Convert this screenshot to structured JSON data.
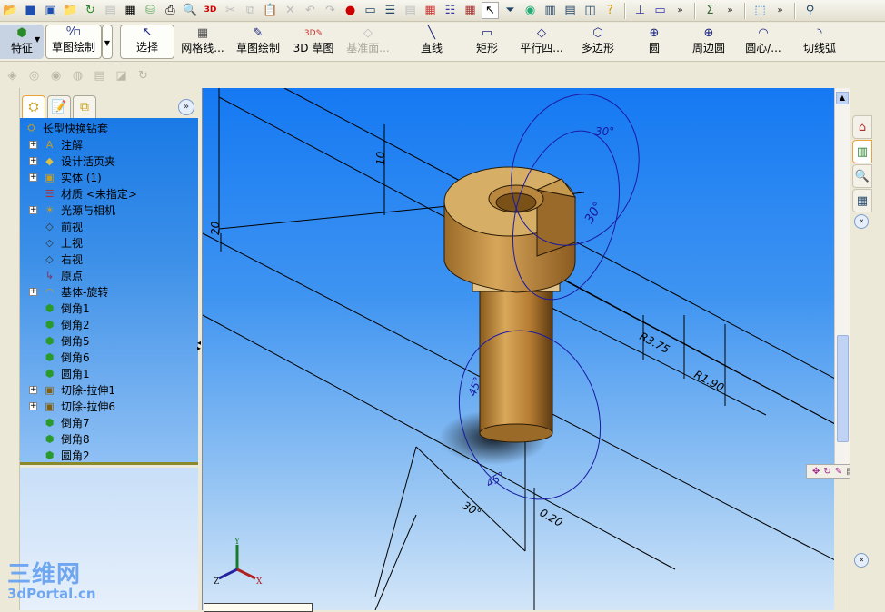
{
  "top_toolbar": {
    "icons": [
      "open-folder-icon",
      "save-icon",
      "save-all-icon",
      "open-icon",
      "rebuild-icon",
      "options-icon",
      "properties-icon",
      "print-setup-icon",
      "print-icon",
      "print-preview-icon",
      "3d-icon",
      "cut-icon",
      "copy-icon",
      "paste-icon",
      "delete-icon",
      "undo-icon",
      "redo-icon",
      "traffic-light-icon",
      "view-layout-icon",
      "list-icon",
      "notes-icon",
      "color-grid-icon",
      "layers-icon",
      "brick-icon",
      "select-arrow-icon",
      "filter-icon",
      "globe-icon",
      "tile-icon",
      "split-icon",
      "window-icon",
      "help-icon",
      "weldment-icon",
      "sheet-icon",
      "equation-icon",
      "box-icon",
      "probe-icon"
    ],
    "more": "»"
  },
  "command_manager": {
    "features_label": "特征",
    "sketch_tab_label": "草图绘制",
    "buttons": [
      {
        "label": "选择",
        "icon": "arrow"
      },
      {
        "label": "网格线...",
        "icon": "grid"
      },
      {
        "label": "草图绘制",
        "icon": "sketch"
      },
      {
        "label": "3D 草图",
        "icon": "3d-sketch"
      },
      {
        "label": "基准面...",
        "icon": "plane",
        "disabled": true
      },
      {
        "label": "直线",
        "icon": "line"
      },
      {
        "label": "矩形",
        "icon": "rectangle"
      },
      {
        "label": "平行四...",
        "icon": "parallelogram"
      },
      {
        "label": "多边形",
        "icon": "polygon"
      },
      {
        "label": "圆",
        "icon": "circle"
      },
      {
        "label": "周边圆",
        "icon": "perimeter-circle"
      },
      {
        "label": "圆心/...",
        "icon": "center-arc"
      },
      {
        "label": "切线弧",
        "icon": "tangent-arc"
      }
    ]
  },
  "feature_tree": {
    "root": "长型快换钻套",
    "items": [
      {
        "label": "注解",
        "expandable": true,
        "icon": "annotation"
      },
      {
        "label": "设计活页夹",
        "expandable": true,
        "icon": "binder"
      },
      {
        "label": "实体 (1)",
        "expandable": true,
        "icon": "solid-body"
      },
      {
        "label": "材质 <未指定>",
        "expandable": false,
        "icon": "material"
      },
      {
        "label": "光源与相机",
        "expandable": true,
        "icon": "lights"
      },
      {
        "label": "前视",
        "expandable": false,
        "icon": "plane"
      },
      {
        "label": "上视",
        "expandable": false,
        "icon": "plane"
      },
      {
        "label": "右视",
        "expandable": false,
        "icon": "plane"
      },
      {
        "label": "原点",
        "expandable": false,
        "icon": "origin"
      },
      {
        "label": "基体-旋转",
        "expandable": true,
        "icon": "revolve"
      },
      {
        "label": "倒角1",
        "expandable": false,
        "icon": "chamfer"
      },
      {
        "label": "倒角2",
        "expandable": false,
        "icon": "chamfer"
      },
      {
        "label": "倒角5",
        "expandable": false,
        "icon": "chamfer"
      },
      {
        "label": "倒角6",
        "expandable": false,
        "icon": "chamfer"
      },
      {
        "label": "圆角1",
        "expandable": false,
        "icon": "fillet"
      },
      {
        "label": "切除-拉伸1",
        "expandable": true,
        "icon": "cut-extrude"
      },
      {
        "label": "切除-拉伸6",
        "expandable": true,
        "icon": "cut-extrude"
      },
      {
        "label": "倒角7",
        "expandable": false,
        "icon": "chamfer"
      },
      {
        "label": "倒角8",
        "expandable": false,
        "icon": "chamfer"
      },
      {
        "label": "圆角2",
        "expandable": false,
        "icon": "fillet"
      }
    ]
  },
  "viewport": {
    "dimensions": {
      "d10": "10",
      "d20": "20",
      "a30_top": "30°",
      "a30_mid": "30°",
      "r375": "R3.75",
      "r190": "R1.90",
      "a45_a": "45°",
      "a45_b": "45°",
      "a30_bot": "30°",
      "d020": "0.20"
    },
    "triad": {
      "x": "X",
      "y": "Y",
      "z": "Z"
    },
    "colors": {
      "part": "#c8954a",
      "sketch": "#1a1aa0",
      "bg_top": "#1579f3",
      "bg_bottom": "#d3e6f8"
    }
  },
  "watermark": {
    "line1": "三维网",
    "line2": "3dPortal.cn"
  }
}
